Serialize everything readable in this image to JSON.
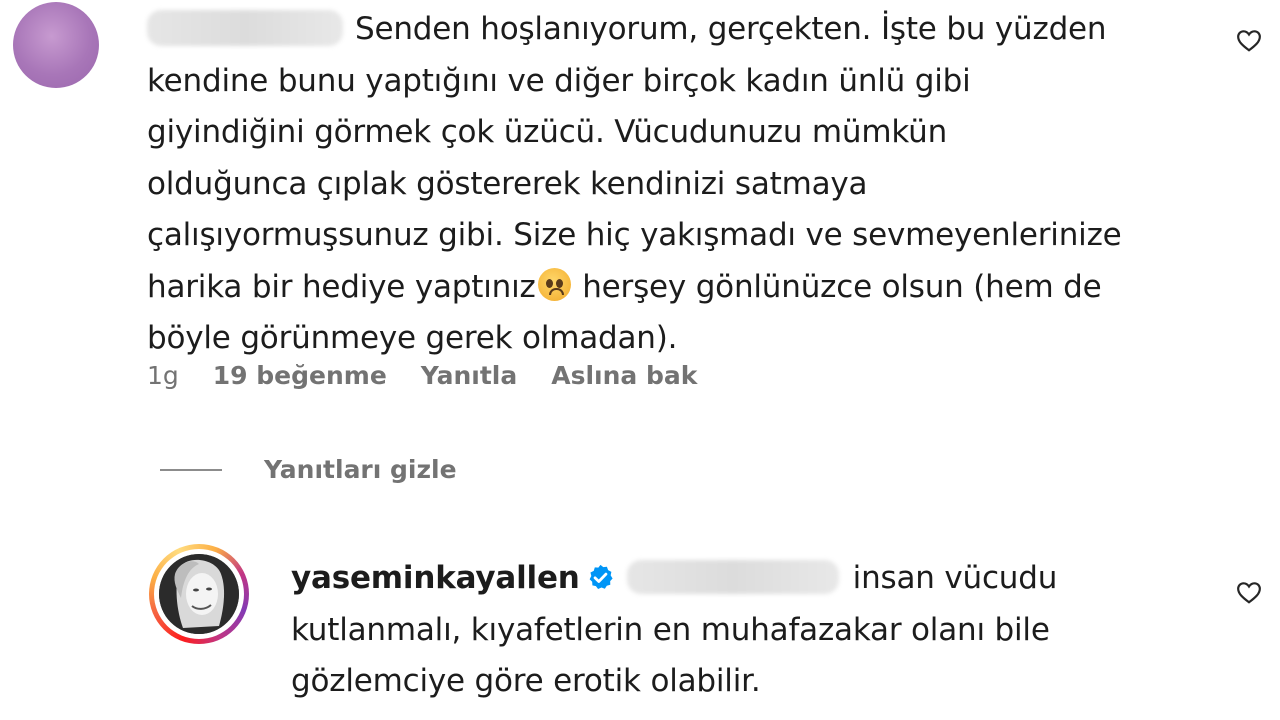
{
  "comment": {
    "text_lines": [
      "Senden hoşlanıyorum, gerçekten. İşte bu yüzden",
      "kendine bunu yaptığını ve diğer birçok kadın ünlü gibi",
      "giyindiğini görmek çok üzücü. Vücudunuzu mümkün",
      "olduğunca çıplak göstererek kendinizi satmaya",
      "çalışıyormuşsunuz gibi. Size hiç yakışmadı ve sevmeyenlerinize"
    ],
    "line6_before_emoji": "harika bir hediye yaptınız",
    "line6_after_emoji": " herşey gönlünüzce olsun (hem de",
    "line7": "böyle görünmeye gerek olmadan).",
    "emoji": "crying-face-emoji",
    "time": "1g",
    "likes": "19 beğenme",
    "reply_label": "Yanıtla",
    "translate_label": "Aslına bak",
    "like_icon": "heart-outline-icon"
  },
  "hide_replies_label": "Yanıtları gizle",
  "reply": {
    "username": "yaseminkayallen",
    "verified_icon": "verified-badge-icon",
    "text_first": "insan vücudu",
    "text_line2": "kutlanmalı, kıyafetlerin en muhafazakar olanı bile",
    "text_line3": "gözlemciye göre erotik olabilir.",
    "like_icon": "heart-outline-icon"
  },
  "colors": {
    "text": "#1c1c1c",
    "secondary": "#737373",
    "verified": "#0095f6"
  }
}
